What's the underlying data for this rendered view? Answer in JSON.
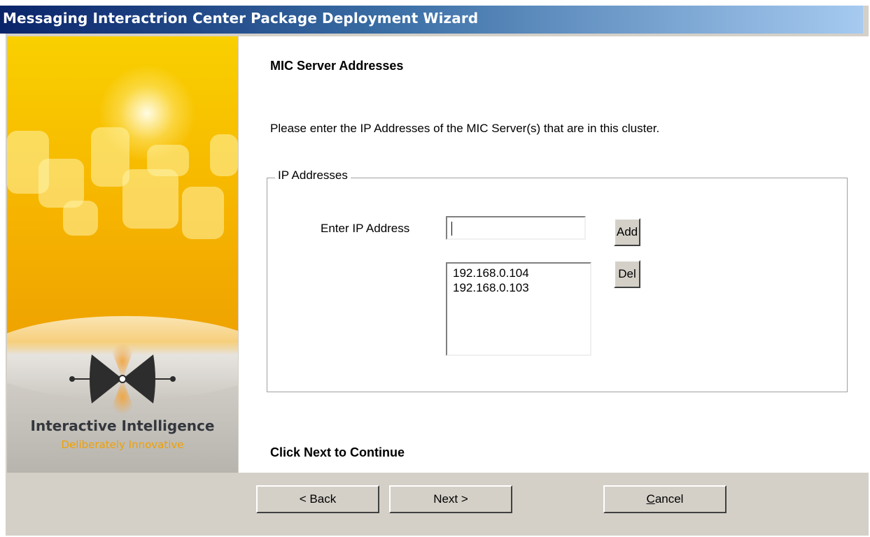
{
  "window": {
    "title": "Messaging Interactrion Center Package Deployment Wizard"
  },
  "banner": {
    "company": "Interactive Intelligence",
    "tagline": "Deliberately Innovative",
    "logo": "interactive-intelligence-logo"
  },
  "page": {
    "heading": "MIC Server Addresses",
    "instructions": "Please enter the IP Addresses of the MIC Server(s) that are in this cluster.",
    "group_label": "IP Addresses",
    "ip_field_label": "Enter IP Address",
    "ip_field_value": "",
    "add_label": "Add",
    "del_label": "Del",
    "addresses": [
      "192.168.0.104",
      "192.168.0.103"
    ],
    "footer": "Click Next to Continue"
  },
  "nav": {
    "back_label": "< Back",
    "next_label": "Next >",
    "cancel_label": "Cancel"
  }
}
